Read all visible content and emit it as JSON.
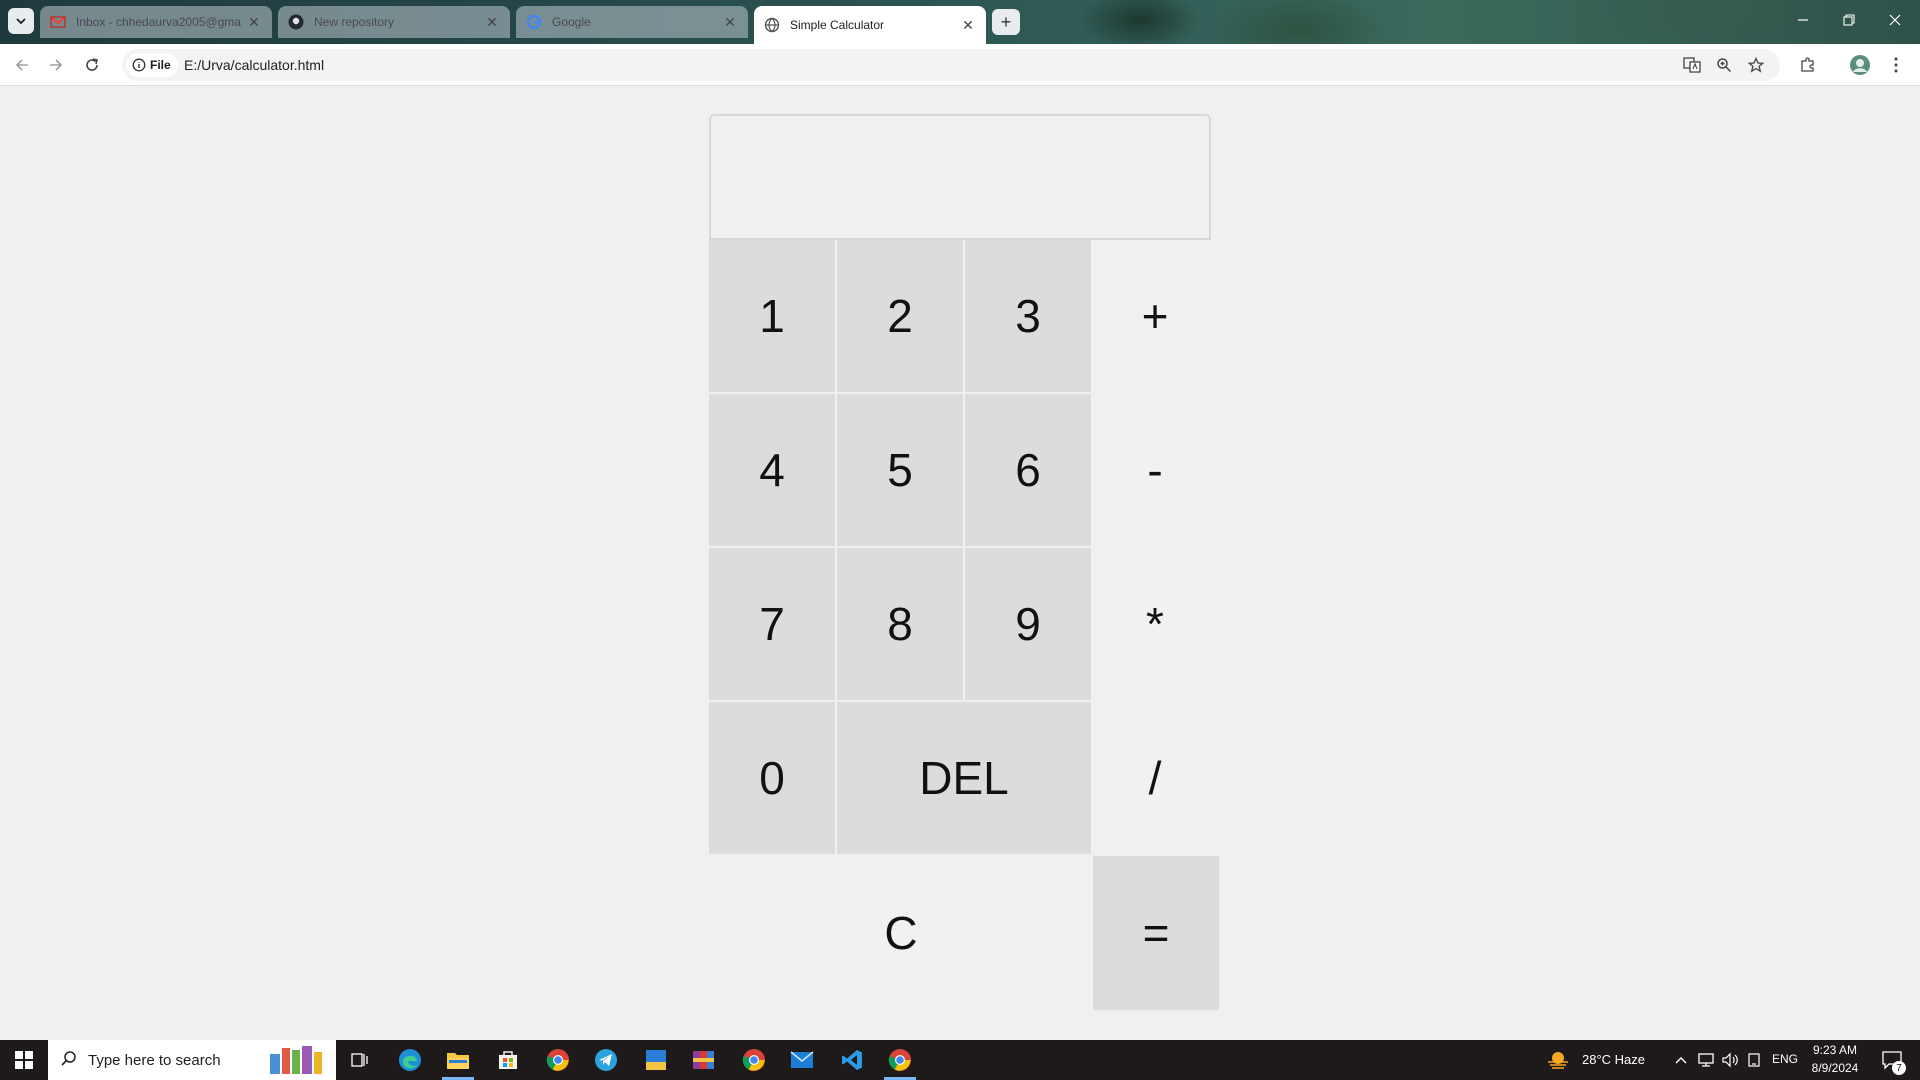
{
  "browser": {
    "tabs": [
      {
        "title": "Inbox - chhedaurva2005@gma",
        "icon": "gmail-icon",
        "active": false
      },
      {
        "title": "New repository",
        "icon": "github-icon",
        "active": false
      },
      {
        "title": "Google",
        "icon": "google-icon",
        "active": false
      },
      {
        "title": "Simple Calculator",
        "icon": "globe-icon",
        "active": true
      }
    ],
    "site_chip": "File",
    "url": "E:/Urva/calculator.html"
  },
  "calculator": {
    "display_value": "",
    "keys": {
      "k1": "1",
      "k2": "2",
      "k3": "3",
      "plus": "+",
      "k4": "4",
      "k5": "5",
      "k6": "6",
      "minus": "-",
      "k7": "7",
      "k8": "8",
      "k9": "9",
      "multiply": "*",
      "k0": "0",
      "del": "DEL",
      "divide": "/",
      "clear": "C",
      "equals": "="
    }
  },
  "taskbar": {
    "search_placeholder": "Type here to search",
    "weather": "28°C  Haze",
    "language": "ENG",
    "time": "9:23 AM",
    "date": "8/9/2024",
    "notification_count": "7"
  },
  "colors": {
    "number_key": "#dcdcdc",
    "operator_key": "#f1f1f1",
    "page_bg": "#f0f0f0"
  }
}
